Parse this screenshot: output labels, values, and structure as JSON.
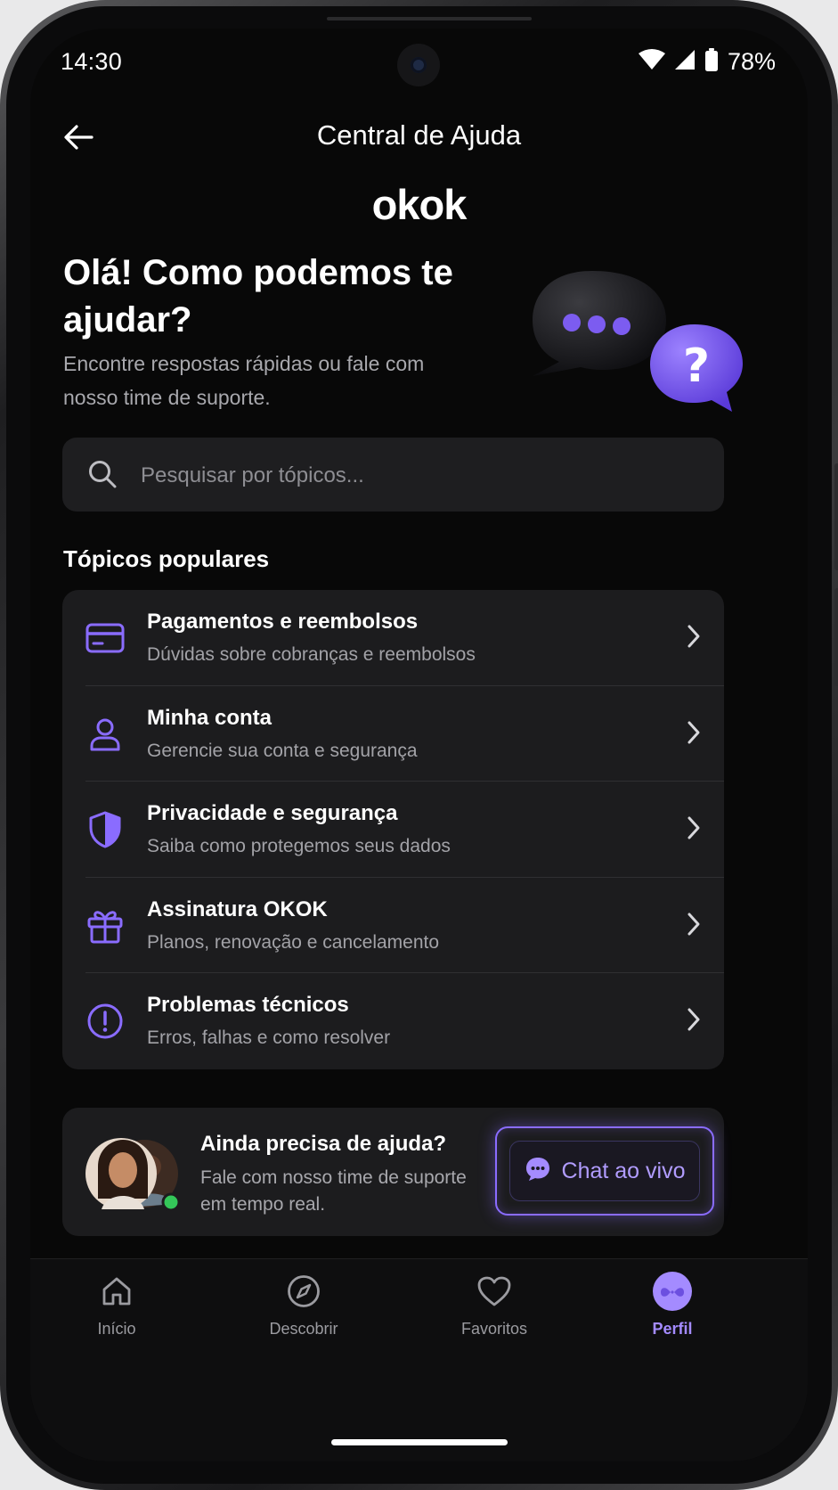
{
  "status": {
    "time": "14:30",
    "battery": "78%"
  },
  "appbar": {
    "title": "Central de Ajuda",
    "back_icon": "arrow-left-icon"
  },
  "brand": {
    "logo": "okok"
  },
  "hero": {
    "title": "Olá! Como podemos te ajudar?",
    "subtitle": "Encontre respostas rápidas ou fale com nosso time de suporte."
  },
  "search": {
    "placeholder": "Pesquisar por tópicos...",
    "value": ""
  },
  "topics": {
    "heading": "Tópicos populares",
    "items": [
      {
        "title": "Pagamentos e reembolsos",
        "subtitle": "Dúvidas sobre cobranças e reembolsos",
        "icon": "credit-card-icon"
      },
      {
        "title": "Minha conta",
        "subtitle": "Gerencie sua conta e segurança",
        "icon": "user-icon"
      },
      {
        "title": "Privacidade e segurança",
        "subtitle": "Saiba como protegemos seus dados",
        "icon": "shield-icon"
      },
      {
        "title": "Assinatura OKOK",
        "subtitle": "Planos, renovação e cancelamento",
        "icon": "gift-icon"
      },
      {
        "title": "Problemas técnicos",
        "subtitle": "Erros, falhas e como resolver",
        "icon": "alert-circle-icon"
      }
    ]
  },
  "support": {
    "title": "Ainda precisa de ajuda?",
    "subtitle": "Fale com nosso time de suporte em tempo real.",
    "button_label": "Chat ao vivo",
    "online_status": "online"
  },
  "nav": {
    "items": [
      {
        "label": "Início",
        "icon": "home-icon",
        "active": false
      },
      {
        "label": "Descobrir",
        "icon": "compass-icon",
        "active": false
      },
      {
        "label": "Favoritos",
        "icon": "heart-icon",
        "active": false
      },
      {
        "label": "Perfil",
        "icon": "profile-avatar-icon",
        "active": true
      }
    ]
  },
  "colors": {
    "accent": "#7b5cf5",
    "accent_light": "#a48bff",
    "background": "#080808",
    "card": "#1c1c1e",
    "online": "#34c759"
  }
}
